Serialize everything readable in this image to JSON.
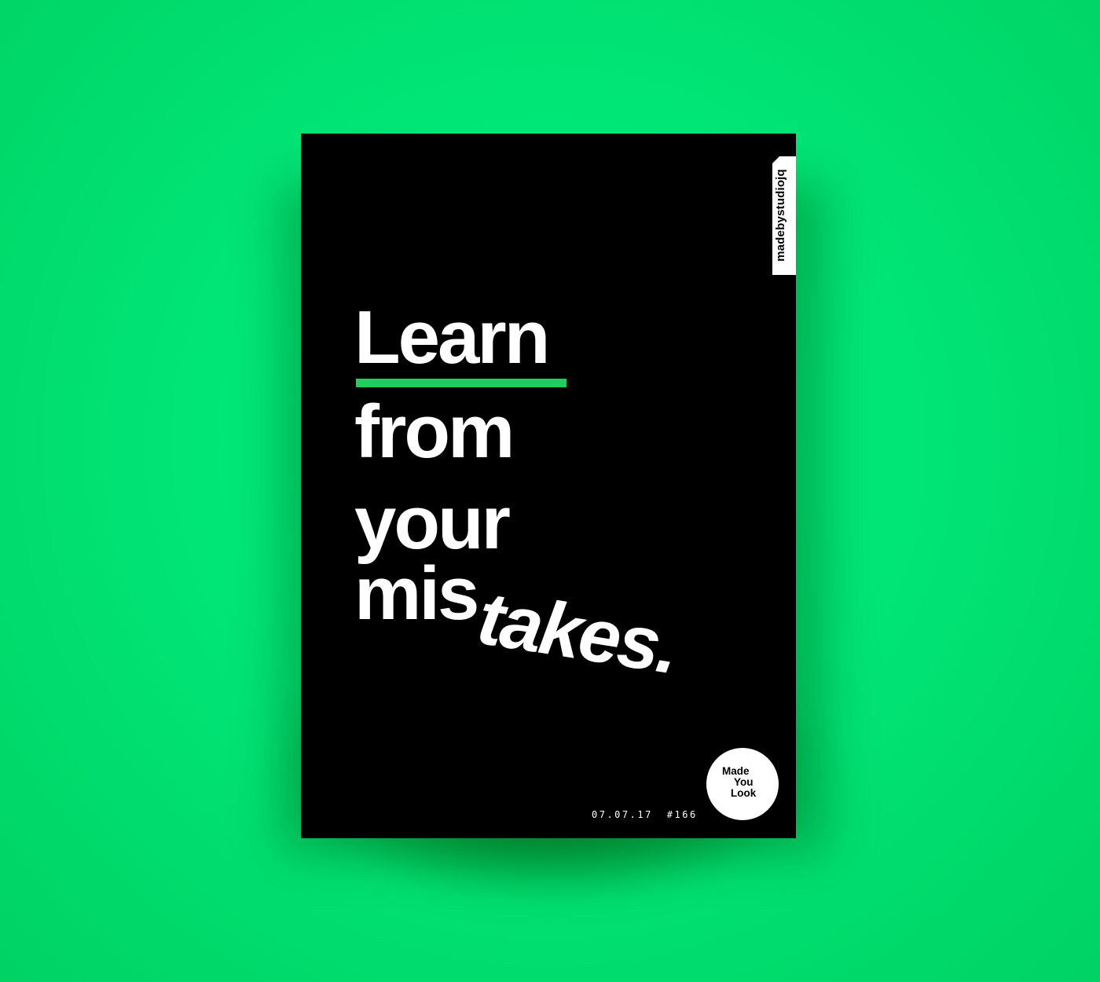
{
  "poster": {
    "tab_label": "madebystudiojq",
    "headline": {
      "line1": "Learn",
      "line2": "from",
      "line3": "your",
      "line4_upright": "mis",
      "line4_slanted": "takes."
    },
    "date": "07.07.17",
    "number": "#166",
    "badge": {
      "line1": "Made",
      "line2": "You",
      "line3": "Look"
    }
  },
  "colors": {
    "background": "#00e676",
    "poster": "#000000",
    "underline_accent": "#1fcf5c",
    "text": "#ffffff"
  }
}
